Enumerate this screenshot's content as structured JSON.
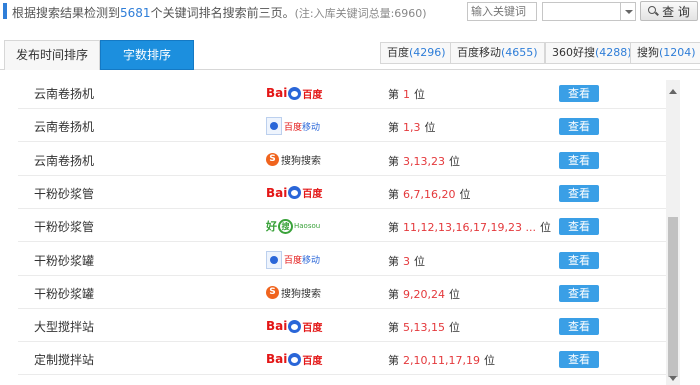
{
  "summary": {
    "prefix": "根据搜索结果检测到",
    "count": "5681",
    "suffix": "个关键词排名搜索前三页。",
    "note": "(注:入库关键词总量:6960)"
  },
  "search": {
    "placeholder": "输入关键词",
    "select_value": "",
    "button_label": "查 询"
  },
  "tabs": [
    {
      "label": "发布时间排序"
    },
    {
      "label": "字数排序"
    }
  ],
  "engines": [
    {
      "name": "百度",
      "count": "(4296)"
    },
    {
      "name": "百度移动",
      "count": "(4655)"
    },
    {
      "name": "360好搜",
      "count": "(4288)"
    },
    {
      "name": "搜狗",
      "count": "(1204)"
    }
  ],
  "rank_prefix": "第",
  "rank_suffix": "位",
  "view_label": "查看",
  "logos": {
    "baidu": {
      "a": "Bai",
      "b": "百度"
    },
    "baidu_mobile": {
      "a": "百度",
      "b": "移动"
    },
    "sogou": {
      "s": "S",
      "t": "搜狗搜索"
    },
    "haosou": {
      "a": "好",
      "b": "搜",
      "c": "Haosou"
    }
  },
  "rows": [
    {
      "keyword": "云南卷扬机",
      "engine": "baidu-logo",
      "positions": "1"
    },
    {
      "keyword": "云南卷扬机",
      "engine": "baidu-mobile-logo",
      "positions": "1,3"
    },
    {
      "keyword": "云南卷扬机",
      "engine": "sogou-logo",
      "positions": "3,13,23"
    },
    {
      "keyword": "干粉砂浆管",
      "engine": "baidu-logo",
      "positions": "6,7,16,20"
    },
    {
      "keyword": "干粉砂浆管",
      "engine": "haosou-logo",
      "positions": "11,12,13,16,17,19,23 ..."
    },
    {
      "keyword": "干粉砂浆罐",
      "engine": "baidu-mobile-logo",
      "positions": "3"
    },
    {
      "keyword": "干粉砂浆罐",
      "engine": "sogou-logo",
      "positions": "9,20,24"
    },
    {
      "keyword": "大型搅拌站",
      "engine": "baidu-logo",
      "positions": "5,13,15"
    },
    {
      "keyword": "定制搅拌站",
      "engine": "baidu-logo",
      "positions": "2,10,11,17,19"
    }
  ]
}
